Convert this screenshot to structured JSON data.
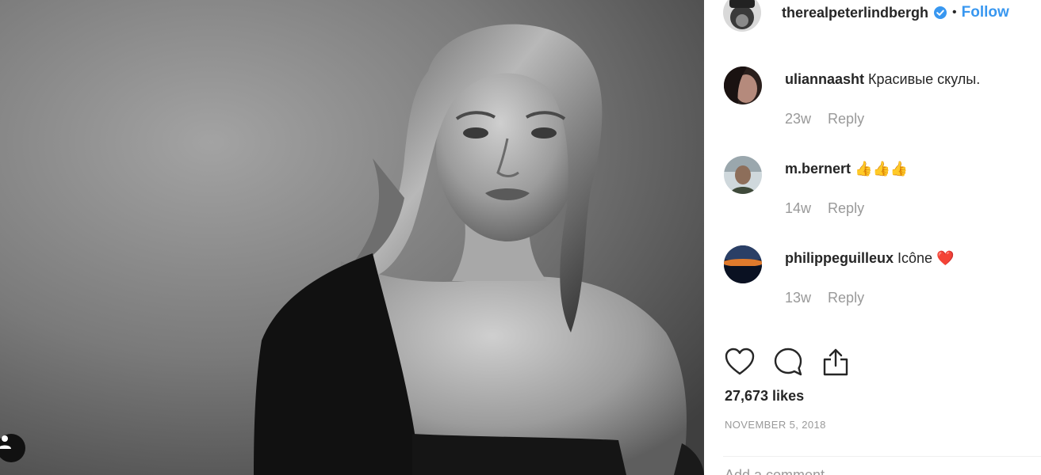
{
  "post": {
    "owner": {
      "username": "therealpeterlindbergh",
      "verified": true,
      "separator": "•",
      "follow_label": "Follow"
    },
    "comments": [
      {
        "username": "uliannaasht",
        "text": "Красивые скулы.",
        "time": "23w",
        "reply_label": "Reply"
      },
      {
        "username": "m.bernert",
        "text": "👍👍👍",
        "time": "14w",
        "reply_label": "Reply"
      },
      {
        "username": "philippeguilleux",
        "text": "Icône ❤️",
        "time": "13w",
        "reply_label": "Reply"
      }
    ],
    "actions": {
      "like_icon": "heart-icon",
      "comment_icon": "speech-bubble-icon",
      "share_icon": "share-icon"
    },
    "likes": "27,673 likes",
    "date": "NOVEMBER 5, 2018",
    "add_comment_placeholder": "Add a comment…"
  },
  "colors": {
    "accent": "#3897f0",
    "text": "#262626",
    "muted": "#999999",
    "verified": "#3897f0"
  }
}
